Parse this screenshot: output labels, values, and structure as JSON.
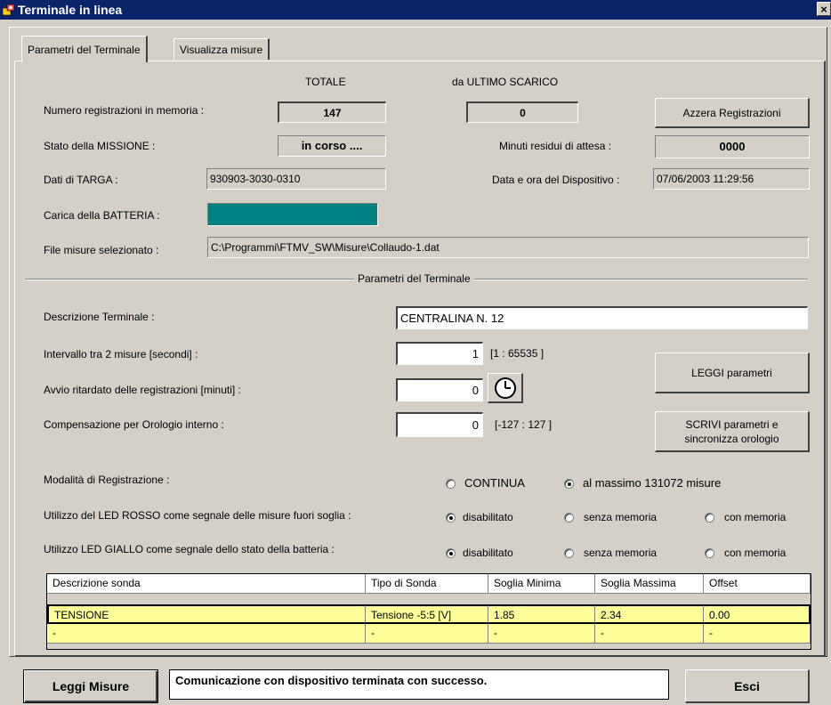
{
  "window": {
    "title": "Terminale in linea",
    "close_glyph": "×"
  },
  "tabs": [
    {
      "label": "Parametri del Terminale",
      "active": true
    },
    {
      "label": "Visualizza misure",
      "active": false
    }
  ],
  "top": {
    "col_totale": "TOTALE",
    "col_ultimo": "da ULTIMO SCARICO",
    "num_reg_label": "Numero registrazioni in memoria :",
    "num_reg_totale": "147",
    "num_reg_ultimo": "0",
    "azzera_button": "Azzera Registrazioni",
    "stato_label": "Stato della MISSIONE :",
    "stato_value": "in corso ....",
    "minuti_label": "Minuti residui di attesa :",
    "minuti_value": "0000",
    "targa_label": "Dati di TARGA :",
    "targa_value": "930903-3030-0310",
    "data_label": "Data e ora del Dispositivo :",
    "data_value": "07/06/2003  11:29:56",
    "batteria_label": "Carica della BATTERIA :",
    "batteria_level": 1.0,
    "file_label": "File misure selezionato :",
    "file_value": "C:\\Programmi\\FTMV_SW\\Misure\\Collaudo-1.dat"
  },
  "params": {
    "group_title": "Parametri del Terminale",
    "descr_label": "Descrizione Terminale :",
    "descr_value": "CENTRALINA  N. 12",
    "intervallo_label": "Intervallo tra 2 misure  [secondi] :",
    "intervallo_value": "1",
    "intervallo_range": "[1 : 65535 ]",
    "avvio_label": "Avvio ritardato delle registrazioni  [minuti] :",
    "avvio_value": "0",
    "comp_label": "Compensazione per Orologio interno :",
    "comp_value": "0",
    "comp_range": "[-127 : 127 ]",
    "leggi_button": "LEGGI parametri",
    "scrivi_button_line1": "SCRIVI parametri e",
    "scrivi_button_line2": "sincronizza orologio",
    "modalita_label": "Modalità di Registrazione :",
    "modalita_opt1": "CONTINUA",
    "modalita_opt2": "al massimo 131072 misure",
    "led_rosso_label": "Utilizzo del LED ROSSO come segnale delle misure fuori soglia :",
    "led_giallo_label": "Utilizzo LED GIALLO come segnale dello stato della batteria :",
    "opt_disab": "disabilitato",
    "opt_senza": "senza memoria",
    "opt_con": "con memoria"
  },
  "table": {
    "headers": [
      "Descrizione sonda",
      "Tipo di Sonda",
      "Soglia Minima",
      "Soglia Massima",
      "Offset"
    ],
    "rows": [
      [
        "TENSIONE",
        "Tensione  -5:5 [V]",
        "1.85",
        "2.34",
        "0.00"
      ],
      [
        "-",
        "-",
        "-",
        "-",
        "-"
      ]
    ]
  },
  "footer": {
    "leggi_misure": "Leggi Misure",
    "status": "Comunicazione con dispositivo terminata con successo.",
    "esci": "Esci"
  },
  "colors": {
    "battery": "#008080",
    "titlebar": "#0a246a",
    "row_highlight": "#ffff99"
  },
  "icons": [
    "app-icon",
    "close-icon",
    "clock-icon"
  ]
}
